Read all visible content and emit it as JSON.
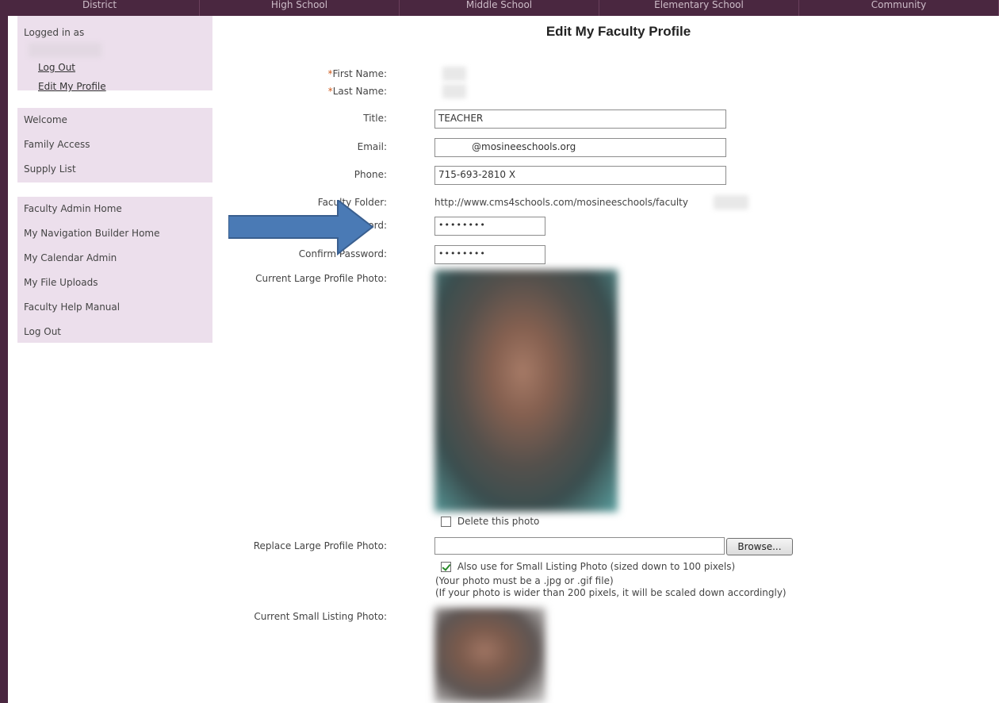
{
  "top_nav": [
    "District",
    "High School",
    "Middle School",
    "Elementary School",
    "Community"
  ],
  "sidebar": {
    "logged_in_label": "Logged in as",
    "account_links": [
      "Log Out",
      "Edit My Profile"
    ],
    "main_items": [
      "Welcome",
      "Family Access",
      "Supply List"
    ],
    "admin_items": [
      "Faculty Admin Home",
      "My Navigation Builder Home",
      "My Calendar Admin",
      "My File Uploads",
      "Faculty Help Manual",
      "Log Out"
    ]
  },
  "page_title": "Edit My Faculty Profile",
  "form": {
    "required_mark": "*",
    "first_name_label": "First Name:",
    "last_name_label": "Last Name:",
    "title_label": "Title:",
    "title_value": "TEACHER",
    "email_label": "Email:",
    "email_value": "@mosineeschools.org",
    "phone_label": "Phone:",
    "phone_value": "715-693-2810 X",
    "folder_label": "Faculty Folder:",
    "folder_value": "http://www.cms4schools.com/mosineeschools/faculty",
    "password_label": "Password:",
    "password_value": "••••••••",
    "confirm_label": "Confirm Password:",
    "confirm_value": "••••••••",
    "current_large_label": "Current Large Profile Photo:",
    "delete_photo_label": "Delete this photo",
    "replace_large_label": "Replace Large Profile Photo:",
    "browse_label": "Browse...",
    "also_use_label": "Also use for Small Listing Photo (sized down to 100 pixels)",
    "note_format": "(Your photo must be a .jpg or .gif file)",
    "note_width": "(If your photo is wider than 200 pixels, it will be scaled down accordingly)",
    "current_small_label": "Current Small Listing Photo:"
  },
  "colors": {
    "nav_bg": "#4a2740",
    "sidebar_bg": "#ecdfec",
    "required": "#d05a1c",
    "arrow": "#4a7ab5"
  }
}
